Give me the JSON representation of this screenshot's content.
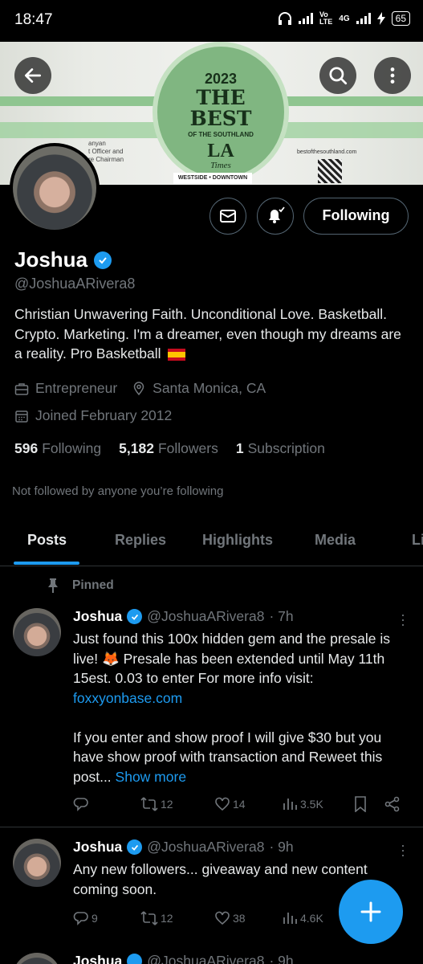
{
  "status": {
    "time": "18:47",
    "battery": "65",
    "network_top": "Vo",
    "network_bottom": "LTE",
    "gen": "4G"
  },
  "banner": {
    "year": "2023",
    "headline": "THE BEST",
    "subhead": "OF THE SOUTHLAND",
    "brand1": "LA",
    "brand2": "Times",
    "location": "WESTSIDE • DOWNTOWN",
    "site": "bestofthesouthland.com",
    "sig_line1": "anyan",
    "sig_line2": "t Officer and",
    "sig_line3": "re Chairman"
  },
  "header": {
    "back_icon": "arrow-left-icon",
    "search_icon": "search-icon",
    "more_icon": "more-vertical-icon"
  },
  "profile": {
    "name": "Joshua",
    "handle": "@JoshuaARivera8",
    "bio": "Christian Unwavering Faith. Unconditional Love. Basketball. Crypto. Marketing. I'm a dreamer, even though my dreams are a reality. Pro Basketball",
    "profession": "Entrepreneur",
    "location": "Santa Monica, CA",
    "joined": "Joined February 2012",
    "following_count": "596",
    "following_label": "Following",
    "followers_count": "5,182",
    "followers_label": "Followers",
    "subscription_count": "1",
    "subscription_label": "Subscription",
    "not_followed": "Not followed by anyone you’re following",
    "follow_button": "Following"
  },
  "tabs": [
    "Posts",
    "Replies",
    "Highlights",
    "Media",
    "Li"
  ],
  "pinned_label": "Pinned",
  "posts": [
    {
      "name": "Joshua",
      "handle": "@JoshuaARivera8",
      "time": "· 7h",
      "text_1": "Just found this 100x hidden gem and the presale is live!  🦊 Presale has been extended until May 11th 15est. 0.03 to enter    For more info visit:",
      "link": "foxxyonbase.com",
      "text_2": "If you enter and show proof I will give $30 but you have show proof with transaction and Reweet this post...",
      "show_more": "Show more",
      "reposts": "12",
      "likes": "14",
      "views": "3.5K"
    },
    {
      "name": "Joshua",
      "handle": "@JoshuaARivera8",
      "time": "· 9h",
      "text": "Any new followers... giveaway and new content coming soon.",
      "replies": "9",
      "reposts": "12",
      "likes": "38",
      "views": "4.6K"
    },
    {
      "name": "Joshua",
      "handle": "@JoshuaARivera8",
      "time": "· 9h"
    }
  ],
  "colors": {
    "accent": "#1d9bf0",
    "muted": "#71767b",
    "divider": "#2f3336",
    "background": "#000000"
  }
}
